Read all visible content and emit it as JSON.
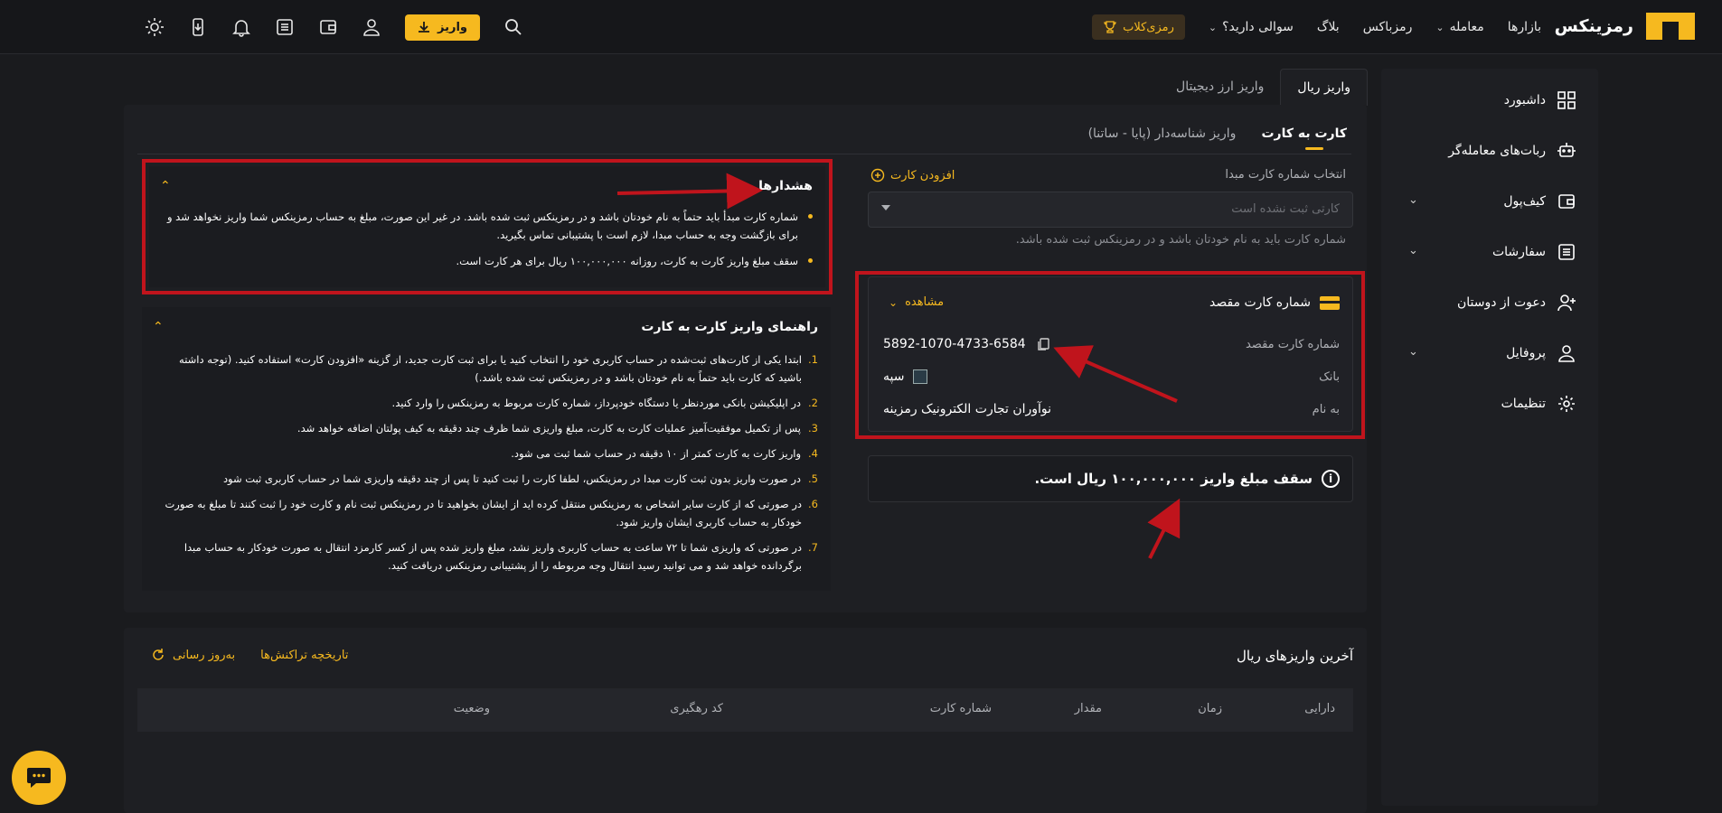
{
  "header": {
    "logo_text": "رمزینکس",
    "nav": [
      "بازارها",
      "معامله",
      "رمزباکس",
      "بلاگ",
      "سوالی دارید؟"
    ],
    "club": "رمزی‌کلاب",
    "deposit": "واریز"
  },
  "sidebar": {
    "items": [
      "داشبورد",
      "ربات‌های معامله‌گر",
      "کیف‌پول",
      "سفارشات",
      "دعوت از دوستان",
      "پروفایل",
      "تنظیمات"
    ]
  },
  "tabs": {
    "rial": "واریز ریال",
    "crypto": "واریز ارز دیجیتال"
  },
  "subtabs": {
    "card": "کارت به کارت",
    "id": "واریز شناسه‌دار (پایا - ساتنا)"
  },
  "form": {
    "label": "انتخاب شماره کارت مبدا",
    "add_card": "افزودن کارت",
    "placeholder": "کارتی ثبت نشده است",
    "hint": "شماره کارت باید به نام خودتان باشد و در رمزینکس ثبت شده باشد."
  },
  "dest": {
    "title": "شماره کارت مقصد",
    "view": "مشاهده",
    "card_label": "شماره کارت مقصد",
    "card_number": "5892-1070-4733-6584",
    "bank_label": "بانک",
    "bank": "سپه",
    "owner_label": "به نام",
    "owner": "نوآوران تجارت الکترونیک رمزینه"
  },
  "limit": {
    "text": "سقف مبلغ واریز ۱۰۰,۰۰۰,۰۰۰ ریال است."
  },
  "warnings": {
    "title": "هشدارها",
    "items": [
      "شماره کارت مبدأ باید حتماً به نام خودتان باشد و در رمزینکس ثبت شده باشد. در غیر این صورت، مبلغ به حساب رمزینکس شما واریز نخواهد شد و برای بازگشت وجه به حساب مبدا، لازم است با پشتیبانی تماس بگیرید.",
      "سقف مبلغ واریز کارت به کارت، روزانه ۱۰۰,۰۰۰,۰۰۰ ریال برای هر کارت است."
    ]
  },
  "guide": {
    "title": "راهنمای واریز کارت به کارت",
    "items": [
      "ابتدا یکی از کارت‌های ثبت‌شده در حساب کاربری خود را انتخاب کنید یا برای ثبت کارت جدید، از گزینه «افزودن کارت» استفاده کنید. (توجه داشته باشید که کارت باید حتماً به نام خودتان باشد و در رمزینکس ثبت شده باشد.)",
      "در اپلیکیشن بانکی موردنظر یا دستگاه خودپرداز، شماره کارت مربوط به رمزینکس را وارد کنید.",
      "پس از تکمیل موفقیت‌آمیز عملیات کارت به کارت، مبلغ واریزی شما ظرف چند دقیقه به کیف پولتان اضافه خواهد شد.",
      "واریز کارت به کارت کمتر از ۱۰ دقیقه در حساب شما ثبت می شود.",
      "در صورت واریز بدون ثبت کارت مبدا در رمزینکس، لطفا کارت را ثبت کنید تا پس از چند دقیقه واریزی شما در حساب کاربری ثبت شود",
      "در صورتی که از کارت سایر اشخاص به رمزینکس منتقل کرده اید از ایشان بخواهید تا در رمزینکس ثبت نام و کارت خود را ثبت کنند تا مبلغ به صورت خودکار به حساب کاربری ایشان واریز شود.",
      "در صورتی که واریزی شما تا ۷۲ ساعت به حساب کاربری واریز نشد، مبلغ واریز شده پس از کسر کارمزد انتقال به صورت خودکار به حساب مبدا برگردانده خواهد شد و می توانید رسید انتقال وجه مربوطه را از پشتیبانی رمزینکس دریافت کنید."
    ]
  },
  "recent": {
    "title": "آخرین واریزهای ریال",
    "history": "تاریخچه تراکنش‌ها",
    "refresh": "به‌روز رسانی",
    "columns": [
      "دارایی",
      "زمان",
      "مقدار",
      "شماره کارت",
      "کد رهگیری",
      "وضعیت"
    ]
  },
  "colors": {
    "accent": "#f6b91f",
    "annotation": "#c0141c",
    "bg": "#1a1b1e"
  }
}
